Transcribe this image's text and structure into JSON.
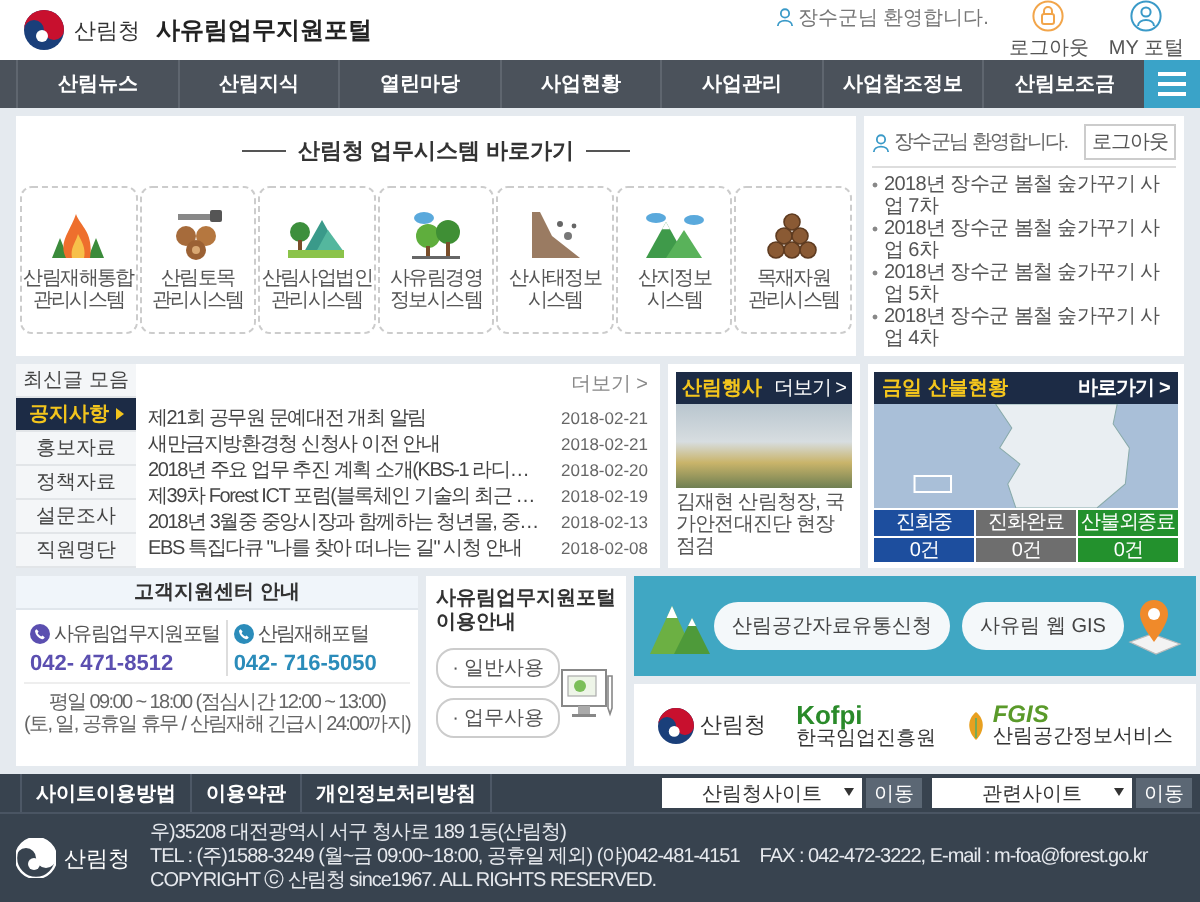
{
  "header": {
    "logo_text": "산림청",
    "site_title": "사유림업무지원포털",
    "greeting": "장수군님 환영합니다.",
    "actions": [
      {
        "label": "로그아웃",
        "kind": "logout"
      },
      {
        "label": "MY 포털",
        "kind": "my"
      }
    ]
  },
  "nav": {
    "items": [
      "산림뉴스",
      "산림지식",
      "열린마당",
      "사업현황",
      "사업관리",
      "사업참조정보",
      "산림보조금"
    ]
  },
  "shortcuts": {
    "title": "산림청 업무시스템 바로가기",
    "items": [
      {
        "label": "산림재해통합\n관리시스템",
        "kind": "fire"
      },
      {
        "label": "산림토목\n관리시스템",
        "kind": "timber"
      },
      {
        "label": "산림사업법인\n관리시스템",
        "kind": "corporation"
      },
      {
        "label": "사유림경영\n정보시스템",
        "kind": "forest"
      },
      {
        "label": "산사태정보\n시스템",
        "kind": "landslide"
      },
      {
        "label": "산지정보\n시스템",
        "kind": "mountain"
      },
      {
        "label": "목재자원\n관리시스템",
        "kind": "wood"
      }
    ]
  },
  "user_panel": {
    "greeting": "장수군님 환영합니다.",
    "logout": "로그아웃",
    "notices": [
      "2018년 장수군 봄철 숲가꾸기 사업 7차",
      "2018년 장수군 봄철 숲가꾸기 사업 6차",
      "2018년 장수군 봄철 숲가꾸기 사업 5차",
      "2018년 장수군 봄철 숲가꾸기 사업 4차"
    ]
  },
  "board": {
    "tabs": [
      {
        "label": "최신글 모음",
        "selected": false
      },
      {
        "label": "공지사항",
        "selected": true
      },
      {
        "label": "홍보자료",
        "selected": false
      },
      {
        "label": "정책자료",
        "selected": false
      },
      {
        "label": "설문조사",
        "selected": false
      },
      {
        "label": "직원명단",
        "selected": false
      }
    ],
    "more": "더보기 >",
    "rows": [
      {
        "title": "제21회 공무원 문예대전 개최 알림",
        "date": "2018-02-21"
      },
      {
        "title": "새만금지방환경청 신청사 이전 안내",
        "date": "2018-02-21"
      },
      {
        "title": "2018년 주요 업무 추진 계획 소개(KBS-1 라디…",
        "date": "2018-02-20"
      },
      {
        "title": "제39차 Forest ICT 포럼(블록체인 기술의 최근 …",
        "date": "2018-02-19"
      },
      {
        "title": "2018년 3월중 중앙시장과 함께하는 청년몰, 중…",
        "date": "2018-02-13"
      },
      {
        "title": "EBS 특집다큐 \"나를 찾아 떠나는 길\" 시청 안내",
        "date": "2018-02-08"
      }
    ]
  },
  "event": {
    "title": "산림행사",
    "more": "더보기 >",
    "caption": "김재현 산림청장, 국가안전대진단 현장 점검"
  },
  "fire": {
    "title": "금일 산불현황",
    "more": "바로가기 >",
    "stats": [
      {
        "label": "진화중",
        "value": "0건",
        "color": "#1d4e9e"
      },
      {
        "label": "진화완료",
        "value": "0건",
        "color": "#6e6e6e"
      },
      {
        "label": "산불외종료",
        "value": "0건",
        "color": "#23912d"
      }
    ]
  },
  "support": {
    "title": "고객지원센터 안내",
    "lines": [
      {
        "name": "사유림업무지원포털",
        "phone": "042- 471-8512",
        "color": "#5b4fb0"
      },
      {
        "name": "산림재해포털",
        "phone": "042- 716-5050",
        "color": "#2b8cba"
      }
    ],
    "hours": "평일 09:00 ~ 18:00 (점심시간 12:00 ~ 13:00)",
    "note": "(토, 일, 공휴일 휴무 / 산림재해 긴급시 24:00까지)"
  },
  "guide": {
    "title": "사유림업무지원포털 이용안내",
    "buttons": [
      "· 일반사용",
      "· 업무사용"
    ]
  },
  "banner": {
    "buttons": [
      "산림공간자료유통신청",
      "사유림 웹 GIS"
    ],
    "logos": [
      {
        "kind": "kfs",
        "text": "산림청"
      },
      {
        "kind": "kofpi",
        "mark": "Kofpi",
        "text": "한국임업진흥원"
      },
      {
        "kind": "fgis",
        "mark": "FGIS",
        "text": "산림공간정보서비스"
      }
    ]
  },
  "footer": {
    "links": [
      "사이트이용방법",
      "이용약관",
      "개인정보처리방침"
    ],
    "selects": [
      {
        "value": "산림청사이트",
        "button": "이동"
      },
      {
        "value": "관련사이트",
        "button": "이동"
      }
    ],
    "logo_text": "산림청",
    "address": "우)35208 대전광역시 서구 청사로 189 1동(산림청)",
    "tel": "TEL : (주)1588-3249 (월~금 09:00~18:00, 공휴일 제외) (야)042-481-4151",
    "fax": "FAX : 042-472-3222, E-mail : m-foa@forest.go.kr",
    "copyright": "COPYRIGHT ⓒ 산림청 since1967. ALL RIGHTS RESERVED."
  }
}
